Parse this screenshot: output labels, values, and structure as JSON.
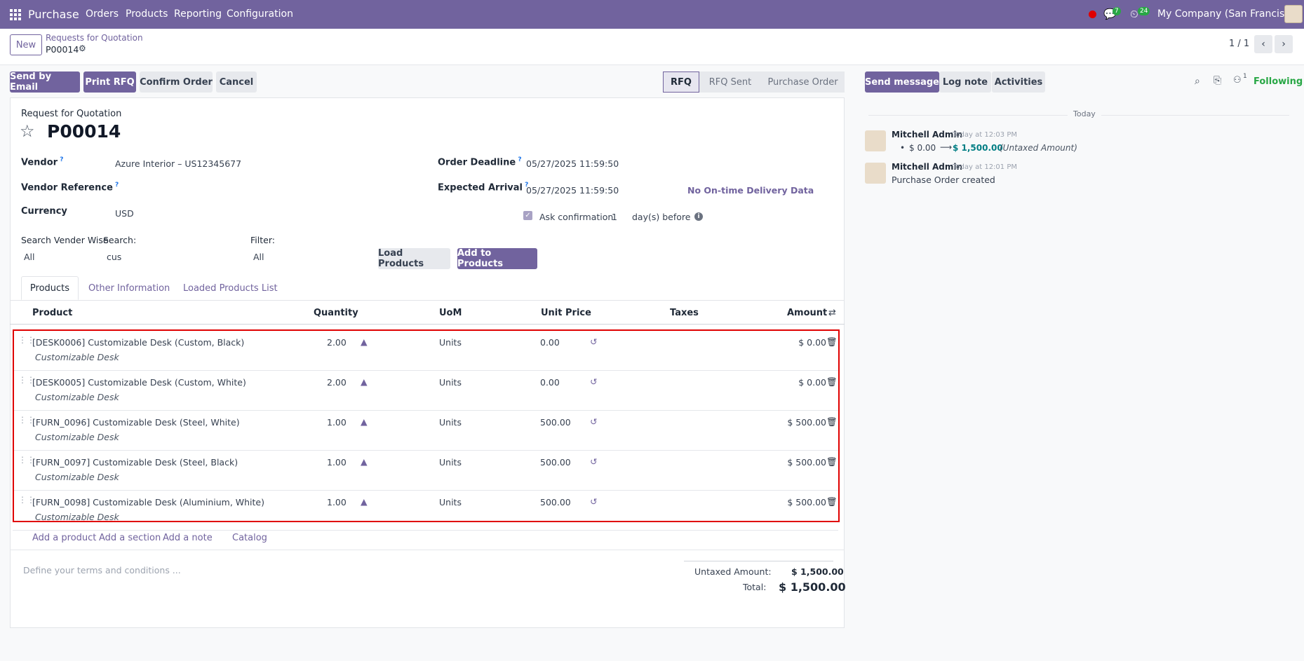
{
  "nav": {
    "app": "Purchase",
    "menus": [
      "Orders",
      "Products",
      "Reporting",
      "Configuration"
    ],
    "chat_count": "7",
    "activity_count": "24",
    "company": "My Company (San Francisco)"
  },
  "control": {
    "new_label": "New",
    "breadcrumb_parent": "Requests for Quotation",
    "breadcrumb_current": "P00014",
    "pager": "1 / 1"
  },
  "actions": {
    "send_email": "Send by Email",
    "print_rfq": "Print RFQ",
    "confirm": "Confirm Order",
    "cancel": "Cancel"
  },
  "stages": [
    "RFQ",
    "RFQ Sent",
    "Purchase Order"
  ],
  "form": {
    "doc_type": "Request for Quotation",
    "name": "P00014",
    "vendor_label": "Vendor",
    "vendor": "Azure Interior – US12345677",
    "vendor_ref_label": "Vendor Reference",
    "currency_label": "Currency",
    "currency": "USD",
    "order_deadline_label": "Order Deadline",
    "order_deadline": "05/27/2025 11:59:50",
    "expected_arrival_label": "Expected Arrival",
    "expected_arrival": "05/27/2025 11:59:50",
    "on_time": "No On-time Delivery Data",
    "ask_confirmation": "Ask confirmation",
    "ask_days": "1",
    "days_before": "day(s) before",
    "search_vendor_label": "Search Vender Wise",
    "search_vendor_value": "All",
    "search_label": "Search:",
    "search_value": "cus",
    "filter_label": "Filter:",
    "filter_value": "All",
    "load_products": "Load Products",
    "add_products": "Add to Products"
  },
  "tabs": [
    "Products",
    "Other Information",
    "Loaded Products List"
  ],
  "columns": [
    "Product",
    "Quantity",
    "UoM",
    "Unit Price",
    "Taxes",
    "Amount"
  ],
  "lines": [
    {
      "product": "[DESK0006] Customizable Desk (Custom, Black)",
      "desc": "Customizable Desk",
      "qty": "2.00",
      "uom": "Units",
      "price": "0.00",
      "amount": "$ 0.00"
    },
    {
      "product": "[DESK0005] Customizable Desk (Custom, White)",
      "desc": "Customizable Desk",
      "qty": "2.00",
      "uom": "Units",
      "price": "0.00",
      "amount": "$ 0.00"
    },
    {
      "product": "[FURN_0096] Customizable Desk (Steel, White)",
      "desc": "Customizable Desk",
      "qty": "1.00",
      "uom": "Units",
      "price": "500.00",
      "amount": "$ 500.00"
    },
    {
      "product": "[FURN_0097] Customizable Desk (Steel, Black)",
      "desc": "Customizable Desk",
      "qty": "1.00",
      "uom": "Units",
      "price": "500.00",
      "amount": "$ 500.00"
    },
    {
      "product": "[FURN_0098] Customizable Desk (Aluminium, White)",
      "desc": "Customizable Desk",
      "qty": "1.00",
      "uom": "Units",
      "price": "500.00",
      "amount": "$ 500.00"
    }
  ],
  "add_links": [
    "Add a product",
    "Add a section",
    "Add a note",
    "Catalog"
  ],
  "terms_placeholder": "Define your terms and conditions ...",
  "totals": {
    "untaxed_label": "Untaxed Amount:",
    "untaxed": "$ 1,500.00",
    "total_label": "Total:",
    "total": "$ 1,500.00"
  },
  "chatter": {
    "send_message": "Send message",
    "log_note": "Log note",
    "activities": "Activities",
    "followers_count": "1",
    "following": "Following",
    "day_sep": "Today",
    "messages": [
      {
        "author": "Mitchell Admin",
        "time": "Today at 12:03 PM",
        "old": "$ 0.00",
        "new": "$ 1,500.00",
        "field": "(Untaxed Amount)"
      },
      {
        "author": "Mitchell Admin",
        "time": "Today at 12:01 PM",
        "body": "Purchase Order created"
      }
    ]
  },
  "colors": {
    "brand": "#71639e",
    "following": "#28a745",
    "highlight": "#e00000"
  }
}
